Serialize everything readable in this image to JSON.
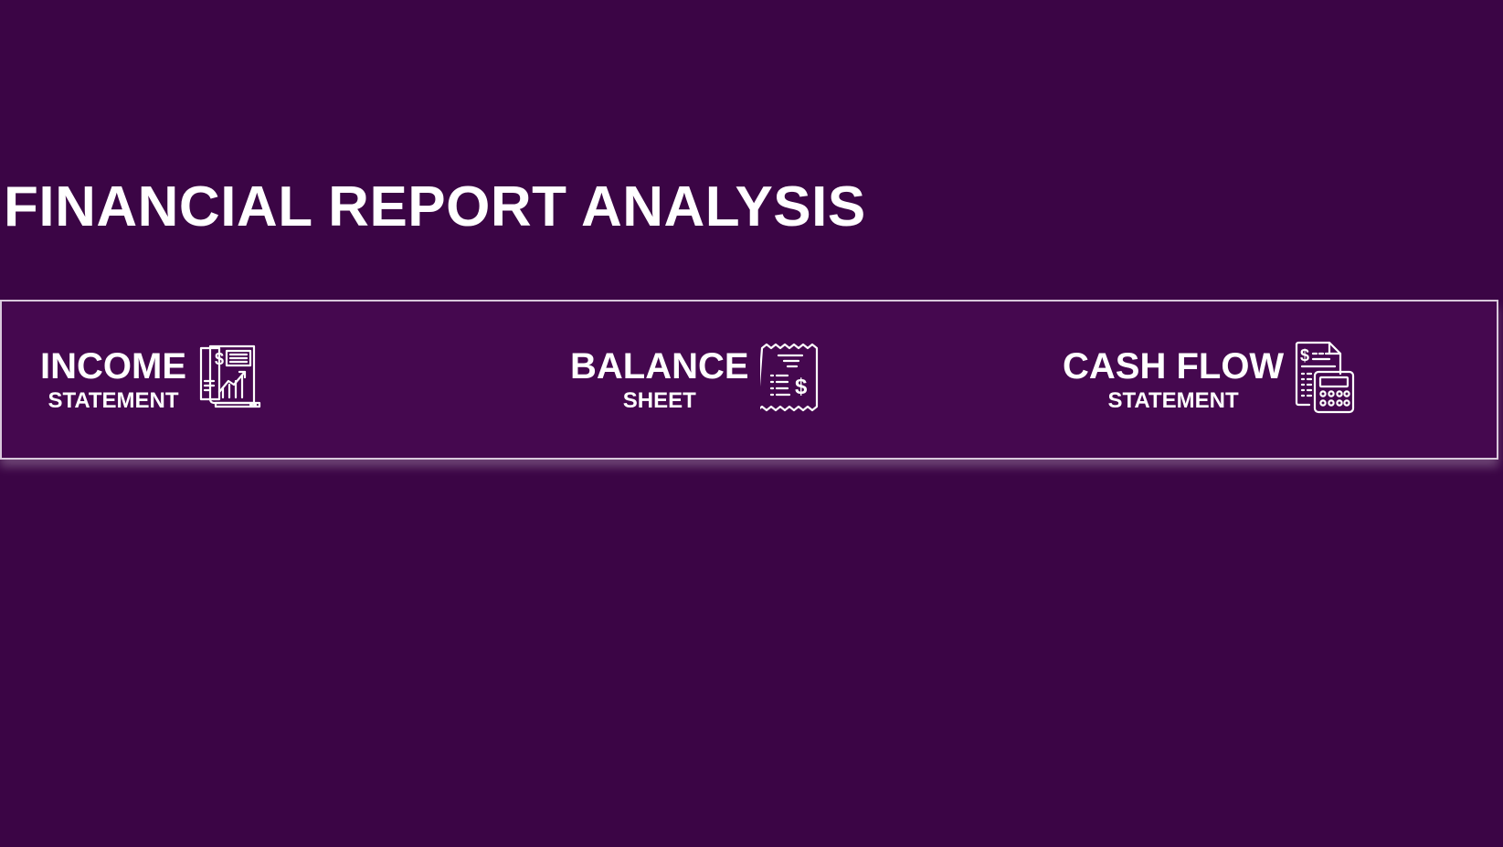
{
  "header": {
    "title": "FINANCIAL REPORT ANALYSIS"
  },
  "nav": {
    "items": [
      {
        "main": "INCOME",
        "sub": "STATEMENT",
        "icon": "income-report-icon"
      },
      {
        "main": "BALANCE",
        "sub": "SHEET",
        "icon": "receipt-icon"
      },
      {
        "main": "CASH FLOW",
        "sub": "STATEMENT",
        "icon": "calculator-document-icon"
      }
    ]
  },
  "colors": {
    "background": "#3b0545",
    "nav_background": "#45084f",
    "text": "#ffffff",
    "border": "#d9c8dc"
  }
}
